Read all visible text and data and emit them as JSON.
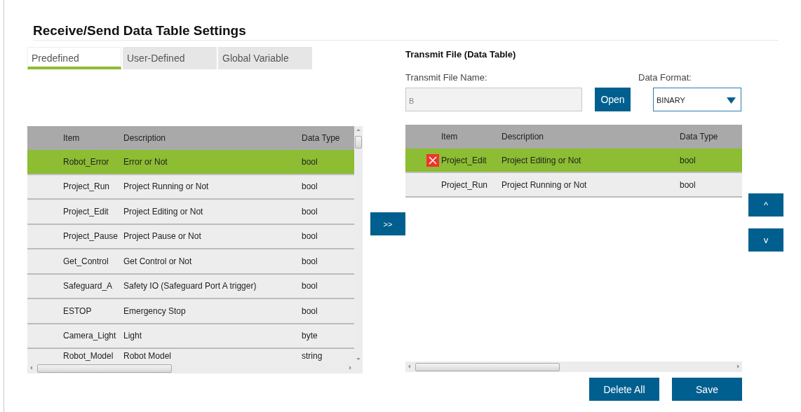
{
  "title": "Receive/Send Data Table Settings",
  "tabs": [
    {
      "label": "Predefined",
      "selected": true
    },
    {
      "label": "User-Defined",
      "selected": false
    },
    {
      "label": "Global Variable",
      "selected": false
    }
  ],
  "source_table": {
    "columns": [
      "Item",
      "Description",
      "Data Type"
    ],
    "rows": [
      {
        "cells": [
          "Robot_Error",
          "Error or Not",
          "bool"
        ],
        "selected": true
      },
      {
        "cells": [
          "Project_Run",
          "Project Running or Not",
          "bool"
        ],
        "selected": false
      },
      {
        "cells": [
          "Project_Edit",
          "Project Editing or Not",
          "bool"
        ],
        "selected": false
      },
      {
        "cells": [
          "Project_Pause",
          "Project Pause or Not",
          "bool"
        ],
        "selected": false
      },
      {
        "cells": [
          "Get_Control",
          "Get Control or Not",
          "bool"
        ],
        "selected": false
      },
      {
        "cells": [
          "Safeguard_A",
          "Safety IO (Safeguard Port A trigger)",
          "bool"
        ],
        "selected": false
      },
      {
        "cells": [
          "ESTOP",
          "Emergency Stop",
          "bool"
        ],
        "selected": false
      },
      {
        "cells": [
          "Camera_Light",
          "Light",
          "byte"
        ],
        "selected": false
      },
      {
        "cells": [
          "Robot_Model",
          "Robot Model",
          "string"
        ],
        "selected": false
      }
    ]
  },
  "add_button": ">>",
  "transmit": {
    "heading": "Transmit File (Data Table)",
    "file_label": "Transmit File Name:",
    "file_value": "B",
    "open_button": "Open",
    "format_label": "Data Format:",
    "format_value": "BINARY"
  },
  "transmit_table": {
    "columns": [
      "Item",
      "Description",
      "Data Type"
    ],
    "rows": [
      {
        "cells": [
          "Project_Edit",
          "Project Editing or Not",
          "bool"
        ],
        "selected": true
      },
      {
        "cells": [
          "Project_Run",
          "Project Running or Not",
          "bool"
        ],
        "selected": false
      }
    ]
  },
  "move_buttons": [
    "^",
    "v"
  ],
  "buttons": [
    "Delete All",
    "Save"
  ]
}
